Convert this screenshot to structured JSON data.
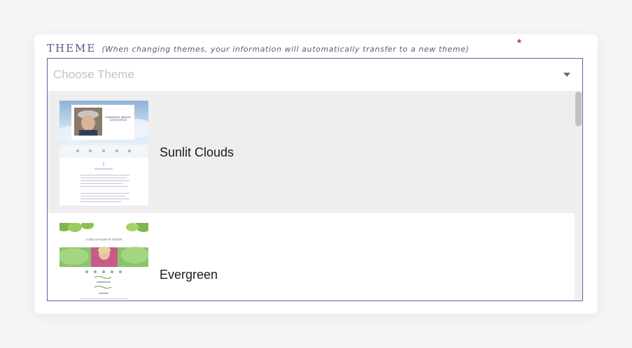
{
  "field": {
    "label": "THEME",
    "note": "(When changing themes, your information will automatically transfer to a new theme)",
    "required_marker": "*",
    "placeholder": "Choose Theme"
  },
  "options": [
    {
      "label": "Sunlit Clouds",
      "thumb_title": "MARSHALL BRANN LIVINGSTON",
      "selected": false,
      "hovered": true
    },
    {
      "label": "Evergreen",
      "thumb_title": "CORA DONAHUE SMITH",
      "selected": false,
      "hovered": false
    }
  ],
  "colors": {
    "label": "#55598f",
    "border": "#5f63a6",
    "required": "#d62a2a",
    "hover_bg": "#eeeeee"
  },
  "icons": {
    "caret": "chevron-down-icon"
  }
}
